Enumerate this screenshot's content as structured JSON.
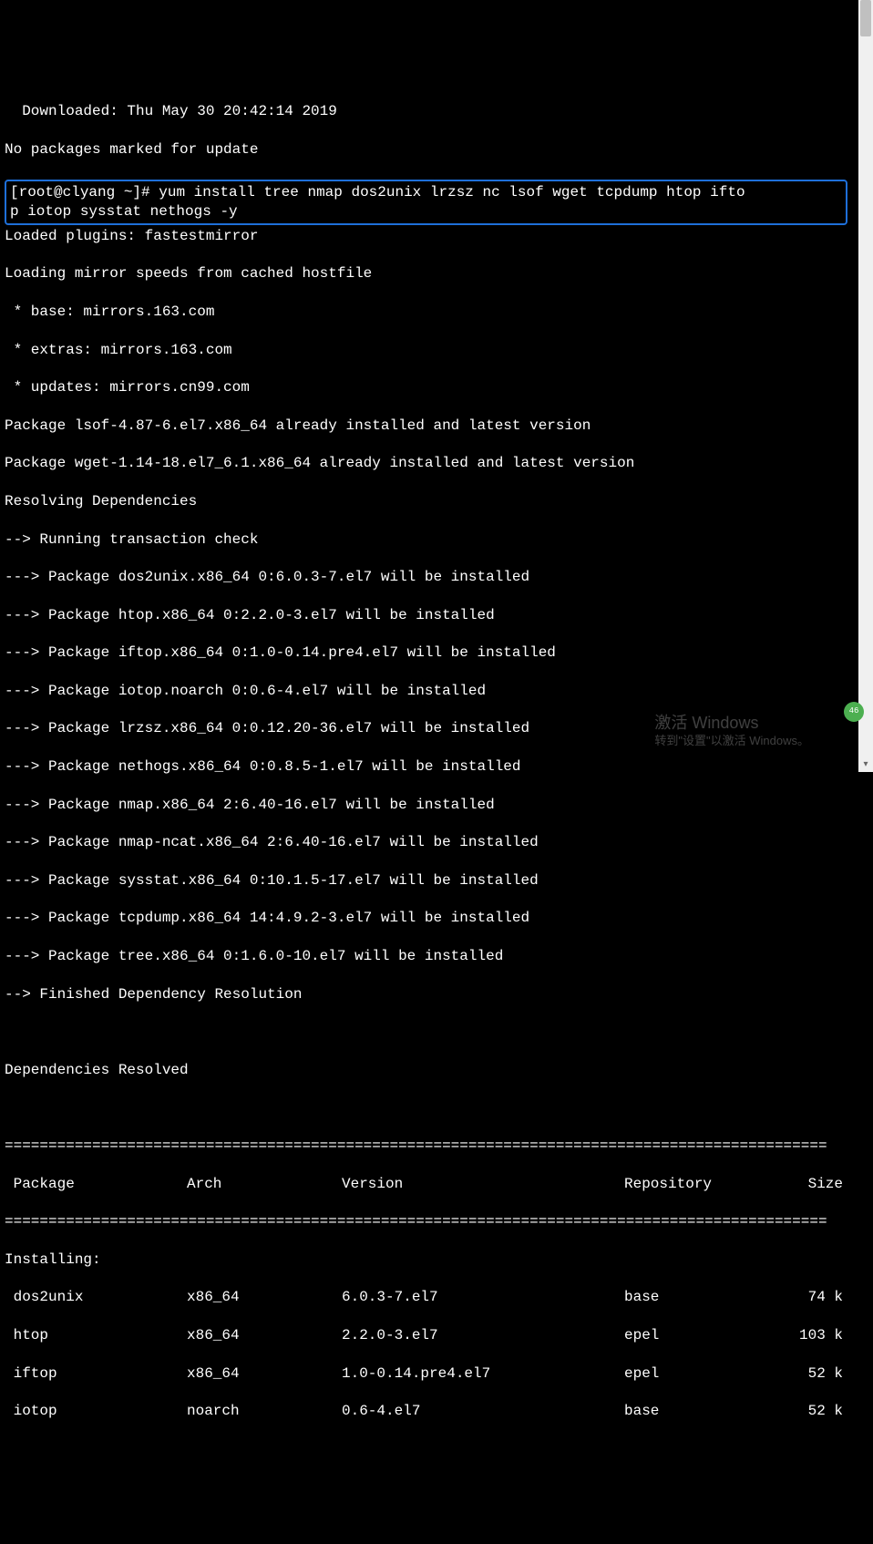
{
  "header": {
    "downloaded": "  Downloaded: Thu May 30 20:42:14 2019",
    "no_packages": "No packages marked for update"
  },
  "command": {
    "prompt": "[root@clyang ~]# ",
    "cmd_line1": "yum install tree nmap dos2unix lrzsz nc lsof wget tcpdump htop ifto",
    "cmd_line2": "p iotop sysstat nethogs -y"
  },
  "output": {
    "loaded_plugins": "Loaded plugins: fastestmirror",
    "loading_mirror": "Loading mirror speeds from cached hostfile",
    "mirror_base": " * base: mirrors.163.com",
    "mirror_extras": " * extras: mirrors.163.com",
    "mirror_updates": " * updates: mirrors.cn99.com",
    "pkg_lsof": "Package lsof-4.87-6.el7.x86_64 already installed and latest version",
    "pkg_wget": "Package wget-1.14-18.el7_6.1.x86_64 already installed and latest version",
    "resolving": "Resolving Dependencies",
    "trans_check": "--> Running transaction check",
    "dep_lines": [
      "---> Package dos2unix.x86_64 0:6.0.3-7.el7 will be installed",
      "---> Package htop.x86_64 0:2.2.0-3.el7 will be installed",
      "---> Package iftop.x86_64 0:1.0-0.14.pre4.el7 will be installed",
      "---> Package iotop.noarch 0:0.6-4.el7 will be installed",
      "---> Package lrzsz.x86_64 0:0.12.20-36.el7 will be installed",
      "---> Package nethogs.x86_64 0:0.8.5-1.el7 will be installed",
      "---> Package nmap.x86_64 2:6.40-16.el7 will be installed",
      "---> Package nmap-ncat.x86_64 2:6.40-16.el7 will be installed",
      "---> Package sysstat.x86_64 0:10.1.5-17.el7 will be installed",
      "---> Package tcpdump.x86_64 14:4.9.2-3.el7 will be installed",
      "---> Package tree.x86_64 0:1.6.0-10.el7 will be installed"
    ],
    "finished_dep": "--> Finished Dependency Resolution",
    "deps_resolved": "Dependencies Resolved"
  },
  "table": {
    "separator": "==============================================================================================",
    "headers": {
      "package": " Package",
      "arch": "Arch",
      "version": "Version",
      "repository": "Repository",
      "size": "Size"
    },
    "installing_label": "Installing:",
    "rows": [
      {
        "pkg": " dos2unix",
        "arch": "x86_64",
        "ver": "6.0.3-7.el7",
        "repo": "base",
        "size": "74 k"
      },
      {
        "pkg": " htop",
        "arch": "x86_64",
        "ver": "2.2.0-3.el7",
        "repo": "epel",
        "size": "103 k"
      },
      {
        "pkg": " iftop",
        "arch": "x86_64",
        "ver": "1.0-0.14.pre4.el7",
        "repo": "epel",
        "size": "52 k"
      },
      {
        "pkg": " iotop",
        "arch": "noarch",
        "ver": "0.6-4.el7",
        "repo": "base",
        "size": "52 k"
      }
    ]
  },
  "watermark": {
    "title": "激活 Windows",
    "subtitle": "转到\"设置\"以激活 Windows。"
  },
  "badge": {
    "value": "46"
  }
}
